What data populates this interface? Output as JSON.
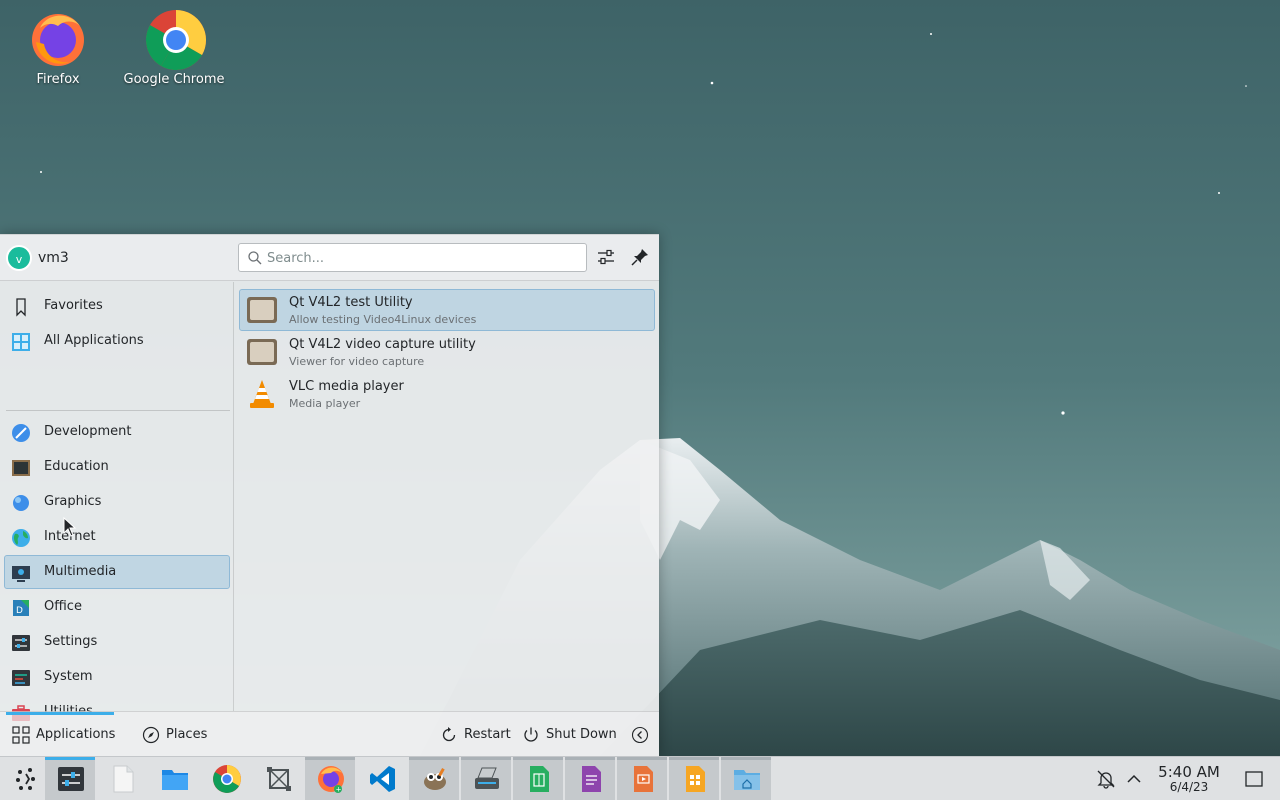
{
  "desktop": {
    "icons": [
      {
        "label": "Firefox",
        "icon": "firefox-icon"
      },
      {
        "label": "Google Chrome",
        "icon": "chrome-icon"
      }
    ]
  },
  "launcher": {
    "user": {
      "initial": "v",
      "name": "vm3"
    },
    "search": {
      "placeholder": "Search..."
    },
    "header_buttons": [
      {
        "icon": "configure-icon"
      },
      {
        "icon": "pin-icon"
      }
    ],
    "categories": [
      {
        "label": "Favorites",
        "icon": "bookmark-icon"
      },
      {
        "label": "All Applications",
        "icon": "grid-icon"
      },
      {
        "label": "Development",
        "icon": "development-icon"
      },
      {
        "label": "Education",
        "icon": "education-icon"
      },
      {
        "label": "Graphics",
        "icon": "graphics-icon"
      },
      {
        "label": "Internet",
        "icon": "globe-icon"
      },
      {
        "label": "Multimedia",
        "icon": "multimedia-icon",
        "active": true
      },
      {
        "label": "Office",
        "icon": "office-icon"
      },
      {
        "label": "Settings",
        "icon": "settings-icon"
      },
      {
        "label": "System",
        "icon": "system-icon"
      },
      {
        "label": "Utilities",
        "icon": "toolbox-icon"
      }
    ],
    "apps": [
      {
        "name": "Qt V4L2 test Utility",
        "description": "Allow testing Video4Linux devices",
        "icon": "tv-icon",
        "active": true
      },
      {
        "name": "Qt V4L2 video capture utility",
        "description": "Viewer for video capture",
        "icon": "tv-icon"
      },
      {
        "name": "VLC media player",
        "description": "Media player",
        "icon": "vlc-cone-icon"
      }
    ],
    "footer": {
      "tabs": [
        {
          "label": "Applications",
          "icon": "applications-grid-icon",
          "active": true
        },
        {
          "label": "Places",
          "icon": "compass-icon"
        }
      ],
      "actions": [
        {
          "label": "Restart",
          "icon": "restart-icon"
        },
        {
          "label": "Shut Down",
          "icon": "power-icon"
        }
      ],
      "more_icon": "chevron-left-icon"
    }
  },
  "taskbar": {
    "items": [
      {
        "icon": "app-launcher-icon"
      },
      {
        "icon": "system-settings-icon",
        "active": true
      },
      {
        "icon": "blank-document-icon"
      },
      {
        "icon": "folder-icon"
      },
      {
        "icon": "chrome-icon"
      },
      {
        "icon": "screenshot-crop-icon"
      },
      {
        "icon": "firefox-icon"
      },
      {
        "icon": "vscode-icon"
      },
      {
        "icon": "gimp-icon"
      },
      {
        "icon": "scanner-icon"
      },
      {
        "icon": "calc-spreadsheet-icon"
      },
      {
        "icon": "notes-icon"
      },
      {
        "icon": "impress-icon"
      },
      {
        "icon": "orange-doc-icon"
      },
      {
        "icon": "home-folder-icon"
      }
    ],
    "tray": [
      {
        "icon": "notifications-icon"
      },
      {
        "icon": "chevron-up-icon"
      }
    ],
    "clock": {
      "time": "5:40 AM",
      "date": "6/4/23"
    },
    "show_desktop_icon": "show-desktop-icon"
  },
  "colors": {
    "accent": "#3daee9",
    "highlight": "#93bedc",
    "avatar": "#1abc9c"
  }
}
